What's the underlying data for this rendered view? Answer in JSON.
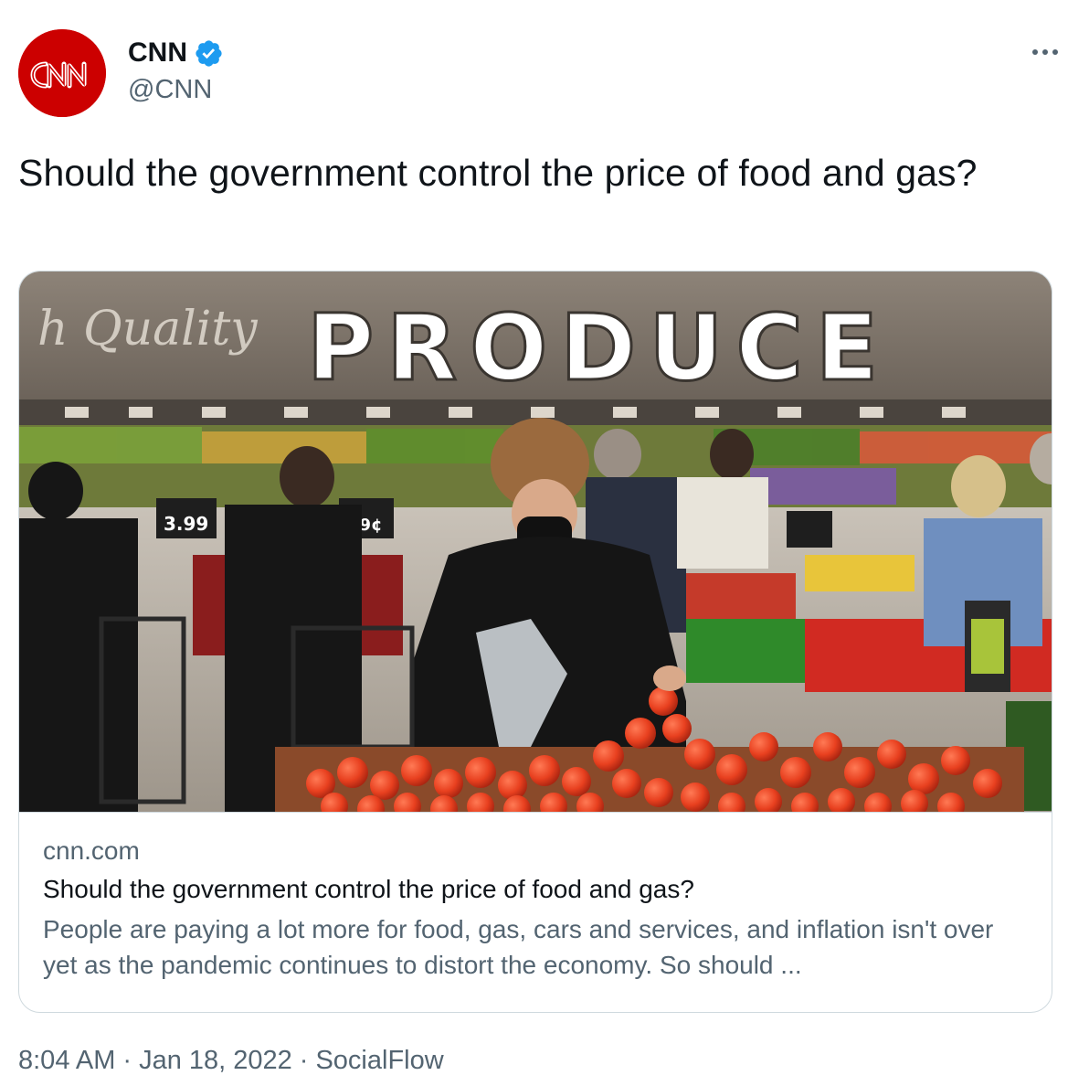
{
  "author": {
    "display_name": "CNN",
    "handle": "@CNN",
    "verified": true,
    "avatar_text": "CNN",
    "brand_color": "#cc0000"
  },
  "tweet": {
    "text": "Should the government control the price of food and gas?"
  },
  "card": {
    "image": "grocery-produce-photo",
    "domain": "cnn.com",
    "title": "Should the government control the price of food and gas?",
    "description": "People are paying a lot more for food, gas, cars and services, and inflation isn't over yet as the pandemic continues to distort the economy. So should ..."
  },
  "meta": {
    "time": "8:04 AM",
    "date": "Jan 18, 2022",
    "source": "SocialFlow",
    "separator": "·"
  },
  "colors": {
    "text_primary": "#0f1419",
    "text_secondary": "#536471",
    "border": "#cfd9de",
    "verified_blue": "#1d9bf0"
  }
}
